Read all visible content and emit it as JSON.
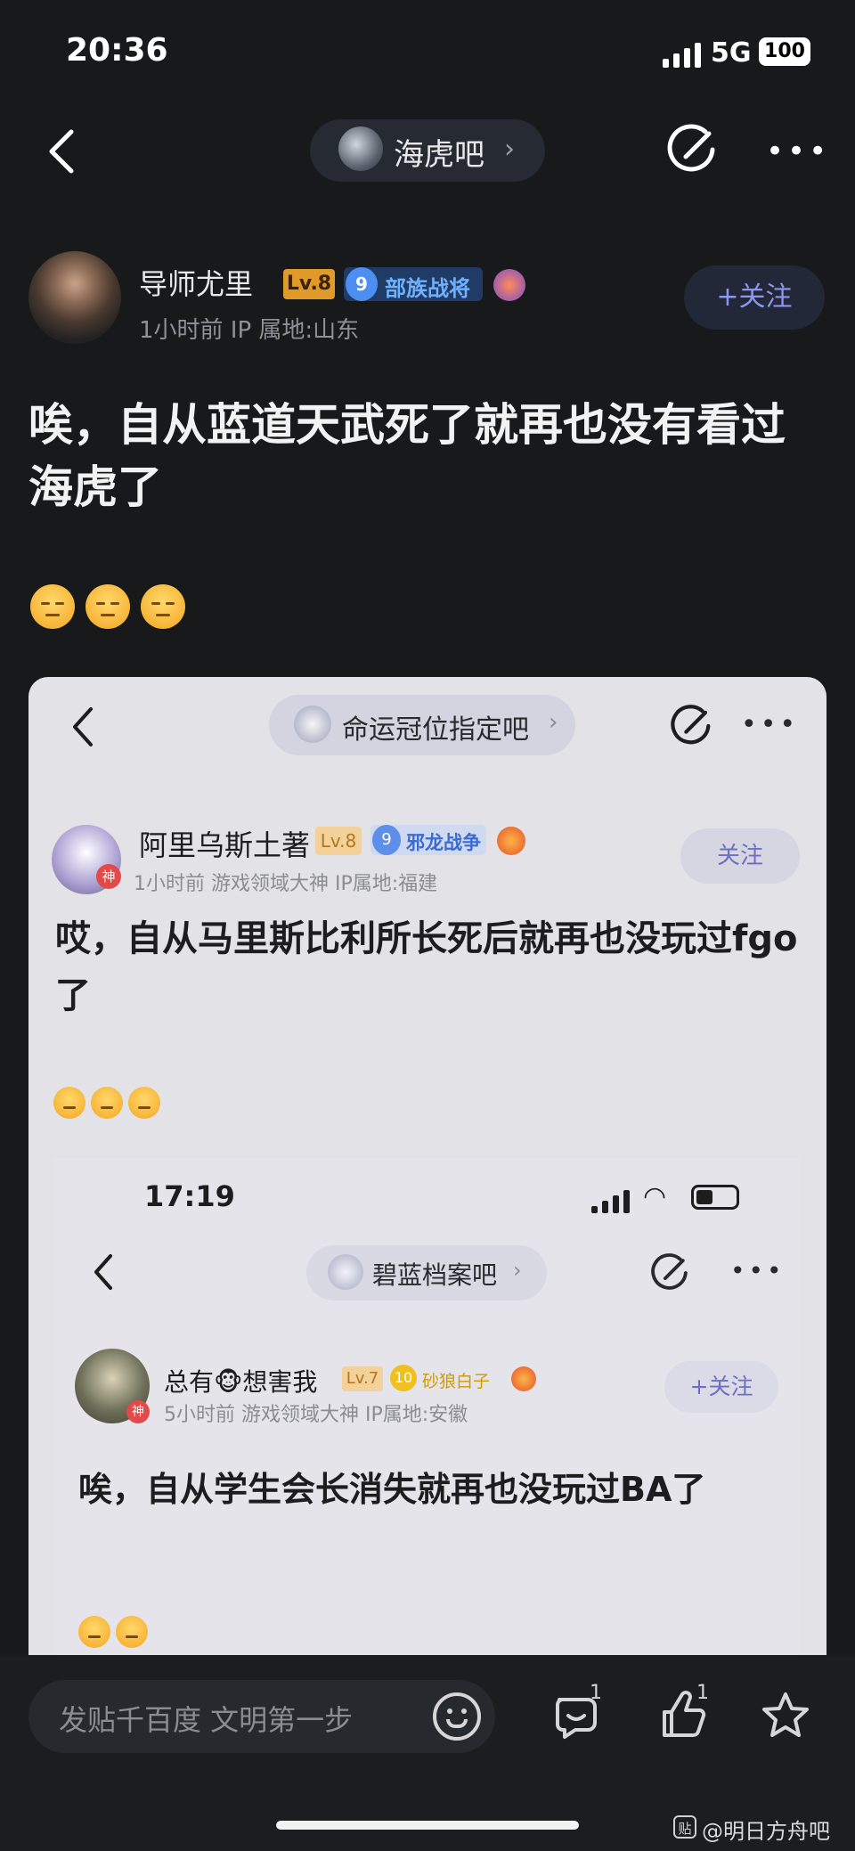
{
  "status_bar": {
    "time": "20:36",
    "network": "5G",
    "battery": "100"
  },
  "nav": {
    "forum_name": "海虎吧"
  },
  "post": {
    "author": "导师尤里",
    "level": "Lv.8",
    "tribe_level": "9",
    "tribe_name": "部族战将",
    "meta": "1小时前   IP 属地:山东",
    "follow_label": "+关注",
    "title": "唉，自从蓝道天武死了就再也没有看过海虎了"
  },
  "embedded_1": {
    "forum_name": "命运冠位指定吧",
    "author": "阿里乌斯土著",
    "level": "Lv.8",
    "tribe_level": "9",
    "tribe_name": "邪龙战争",
    "badge": "神",
    "meta": "1小时前    游戏领域大神  IP属地:福建",
    "follow_label": "关注",
    "title": "哎，自从马里斯比利所长死后就再也没玩过fgo了"
  },
  "embedded_2": {
    "time": "17:19",
    "forum_name": "碧蓝档案吧",
    "author": "总有🐵想害我",
    "level": "Lv.7",
    "tribe_level": "10",
    "tribe_name": "砂狼白子",
    "badge": "神",
    "meta": "5小时前   游戏领域大神   IP属地:安徽",
    "follow_label": "+关注",
    "title": "唉，自从学生会长消失就再也没玩过BA了"
  },
  "bottom_bar": {
    "input_placeholder": "发贴千百度 文明第一步",
    "comment_count": "1",
    "like_count": "1"
  },
  "watermark": {
    "icon_text": "贴",
    "text": "@明日方舟吧"
  },
  "icons": [
    "back-icon",
    "edit-icon",
    "more-icon",
    "smile-icon",
    "comment-icon",
    "like-icon",
    "star-icon",
    "pensive-emoji"
  ]
}
